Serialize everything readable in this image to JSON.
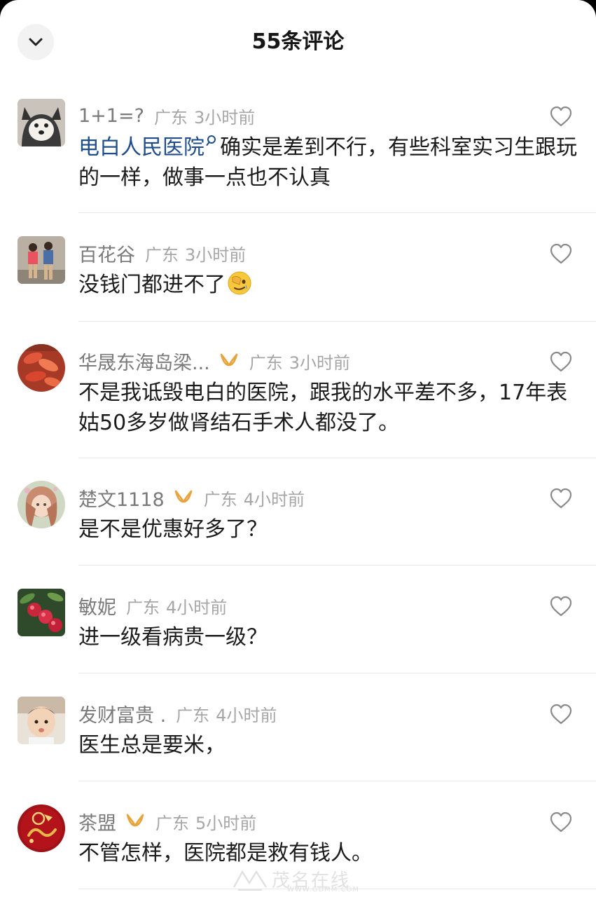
{
  "header": {
    "title": "55条评论"
  },
  "colors": {
    "link": "#1f4c8b",
    "badge": "#e8a33a",
    "muted": "#a6a6a6"
  },
  "comments": [
    {
      "nickname": "1+1=?",
      "location": "广东",
      "time": "3小时前",
      "link_text": "电白人民医院",
      "text": "确实是差到不行，有些科室实习生跟玩的一样，做事一点也不认真"
    },
    {
      "nickname": "百花谷",
      "location": "广东",
      "time": "3小时前",
      "text": "没钱门都进不了"
    },
    {
      "nickname": "华晟东海岛梁...",
      "location": "广东",
      "time": "3小时前",
      "text": "不是我诋毁电白的医院，跟我的水平差不多，17年表姑50多岁做肾结石手术人都没了。"
    },
    {
      "nickname": "楚文1118",
      "location": "广东",
      "time": "4小时前",
      "text": "是不是优惠好多了？"
    },
    {
      "nickname": "敏妮",
      "location": "广东",
      "time": "4小时前",
      "text": "进一级看病贵一级？"
    },
    {
      "nickname": "发财富贵 .",
      "location": "广东",
      "time": "4小时前",
      "text": "医生总是要米，"
    },
    {
      "nickname": "茶盟",
      "location": "广东",
      "time": "5小时前",
      "text": "不管怎样，医院都是救有钱人。"
    }
  ],
  "watermark": {
    "text": "茂名在线",
    "sub": "WWW.GDMM.COM"
  }
}
